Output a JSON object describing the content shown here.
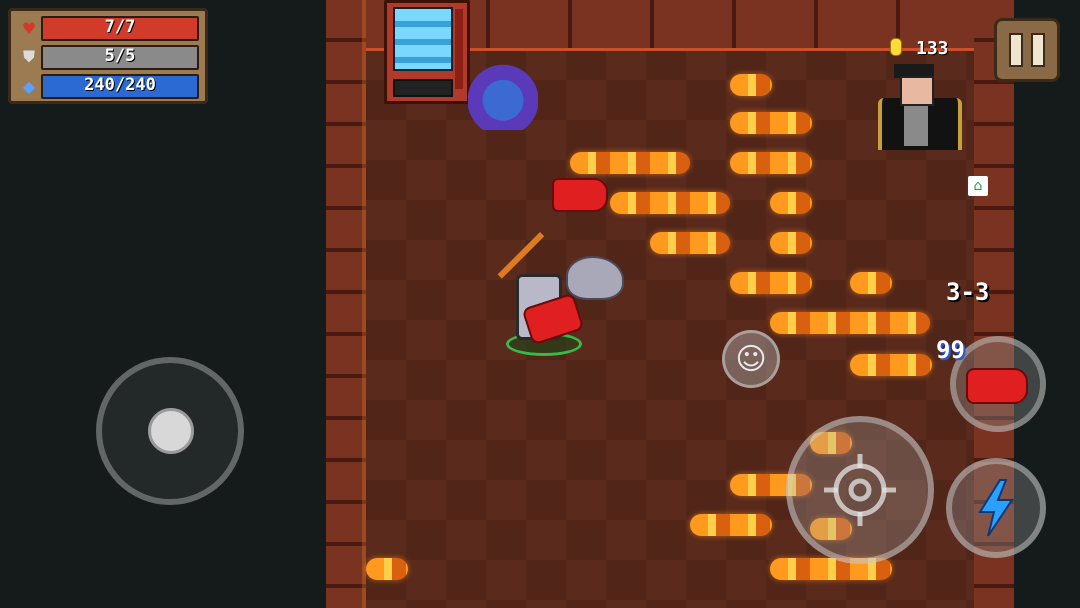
{
  "hud": {
    "health": {
      "value": "7/7",
      "level": 1.0,
      "color": "#d23a2a"
    },
    "armor": {
      "value": "5/5",
      "level": 1.0,
      "color": "#8a8a8a"
    },
    "energy": {
      "value": "240/240",
      "level": 1.0,
      "color": "#2a6ad2"
    }
  },
  "coins": "133",
  "level": "3-3",
  "weapon": {
    "ammo": "99",
    "icon": "red-glove-icon"
  },
  "icons": {
    "health": "heart-icon",
    "armor": "shield-icon",
    "energy": "diamond-icon",
    "coin": "coin-icon",
    "pause": "pause-icon",
    "emote": "smiley-icon",
    "attack": "crosshair-icon",
    "skill": "lightning-icon",
    "minimap": "home-icon"
  },
  "glyphs": {
    "heart": "♥",
    "shield": "⛊",
    "diamond": "◆",
    "emote": "☺",
    "home": "⌂"
  }
}
